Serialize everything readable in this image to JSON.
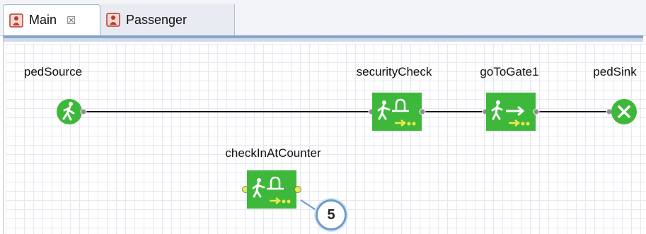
{
  "tabs": [
    {
      "label": "Main",
      "active": true,
      "close_glyph": "☒",
      "icon": "agent-class-icon"
    },
    {
      "label": "Passenger",
      "active": false,
      "icon": "agent-class-icon"
    }
  ],
  "blocks": {
    "pedSource": {
      "label": "pedSource",
      "icon": "ped-source-icon"
    },
    "securityCheck": {
      "label": "securityCheck",
      "icon": "ped-service-icon"
    },
    "goToGate1": {
      "label": "goToGate1",
      "icon": "ped-goto-icon"
    },
    "pedSink": {
      "label": "pedSink",
      "icon": "ped-sink-icon"
    },
    "checkInAtCounter": {
      "label": "checkInAtCounter",
      "icon": "ped-service-icon",
      "selected": true
    }
  },
  "callout": {
    "number": "5"
  },
  "colors": {
    "block_green": "#3db83a",
    "port_gray": "#8f8f8f",
    "selected_port": "#e6e86a",
    "callout_border": "#6e9ad0"
  }
}
